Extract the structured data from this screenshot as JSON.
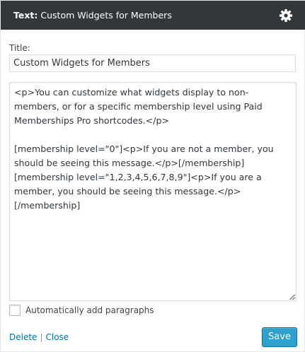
{
  "header": {
    "prefix": "Text:",
    "widget_title": "Custom Widgets for Members",
    "settings_icon": "gear-icon",
    "background_color": "#32373c"
  },
  "form": {
    "title_label": "Title:",
    "title_value": "Custom Widgets for Members",
    "content_value": "<p>You can customize what widgets display to non-members, or for a specific membership level using Paid Memberships Pro shortcodes.</p>\n\n[membership level=\"0\"]<p>If you are not a member, you should be seeing this message.</p>[/membership]\n[membership level=\"1,2,3,4,5,6,7,8,9\"]<p>If you are a member, you should be seeing this message.</p>\n[/membership]",
    "autop_label": "Automatically add paragraphs",
    "autop_checked": false
  },
  "footer": {
    "delete_label": "Delete",
    "separator": "|",
    "close_label": "Close",
    "save_label": "Save",
    "save_color": "#2ea2cc"
  }
}
